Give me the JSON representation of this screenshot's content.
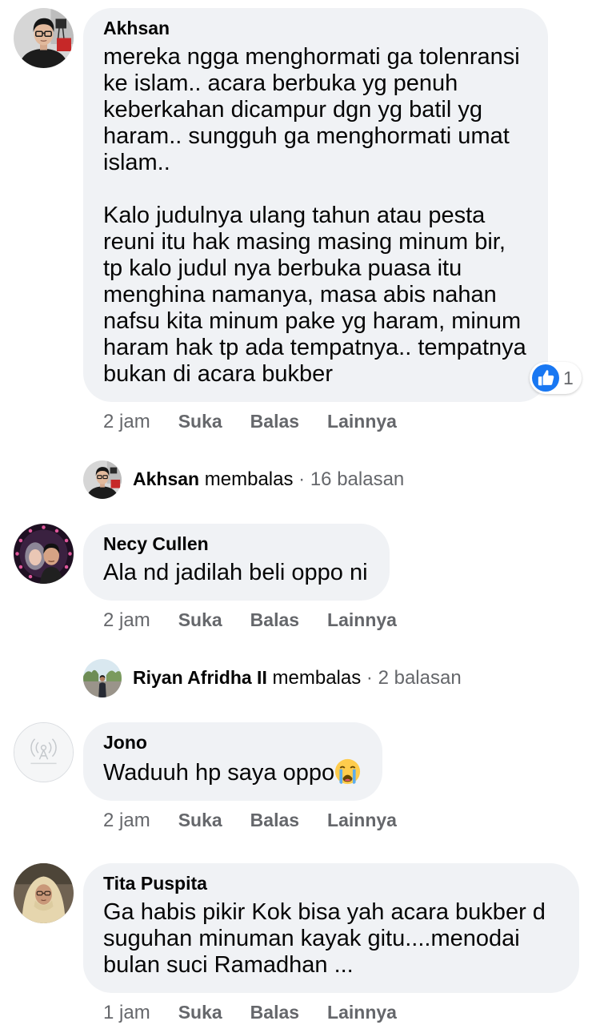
{
  "comments": [
    {
      "author": "Akhsan",
      "text": "mereka ngga menghormati ga tolenransi\nke islam.. acara berbuka yg penuh\nkeberkahan dicampur dgn yg batil yg\nharam.. sungguh ga menghormati umat\nislam..\n\nKalo judulnya ulang tahun atau pesta\nreuni itu hak masing masing minum bir,\ntp kalo judul nya berbuka puasa itu\nmenghina namanya, masa abis nahan\nnafsu kita minum pake yg haram, minum\nharam hak tp ada tempatnya.. tempatnya\nbukan di acara bukber",
      "reaction": {
        "icon": "like-icon",
        "count": "1"
      },
      "time": "2 jam",
      "replies": {
        "author": "Akhsan",
        "verb": "membalas",
        "separator": "·",
        "count": "16 balasan"
      }
    },
    {
      "author": "Necy Cullen",
      "text": "Ala nd jadilah beli oppo ni",
      "time": "2 jam",
      "replies": {
        "author": "Riyan Afridha II",
        "verb": "membalas",
        "separator": "·",
        "count": "2 balasan"
      }
    },
    {
      "author": "Jono",
      "text": "Waduuh hp saya oppo",
      "emoji": "loudly-crying-face-emoji",
      "time": "2 jam"
    },
    {
      "author": "Tita Puspita",
      "text": "Ga habis pikir Kok bisa yah acara bukber d\nsuguhan minuman kayak gitu....menodai\nbulan suci Ramadhan ...",
      "time": "1 jam"
    }
  ],
  "action_labels": {
    "like": "Suka",
    "reply": "Balas",
    "more": "Lainnya"
  },
  "colors": {
    "bubble": "#f0f2f5",
    "primary_text": "#050505",
    "secondary_text": "#65676b",
    "like_blue": "#1877f2"
  }
}
